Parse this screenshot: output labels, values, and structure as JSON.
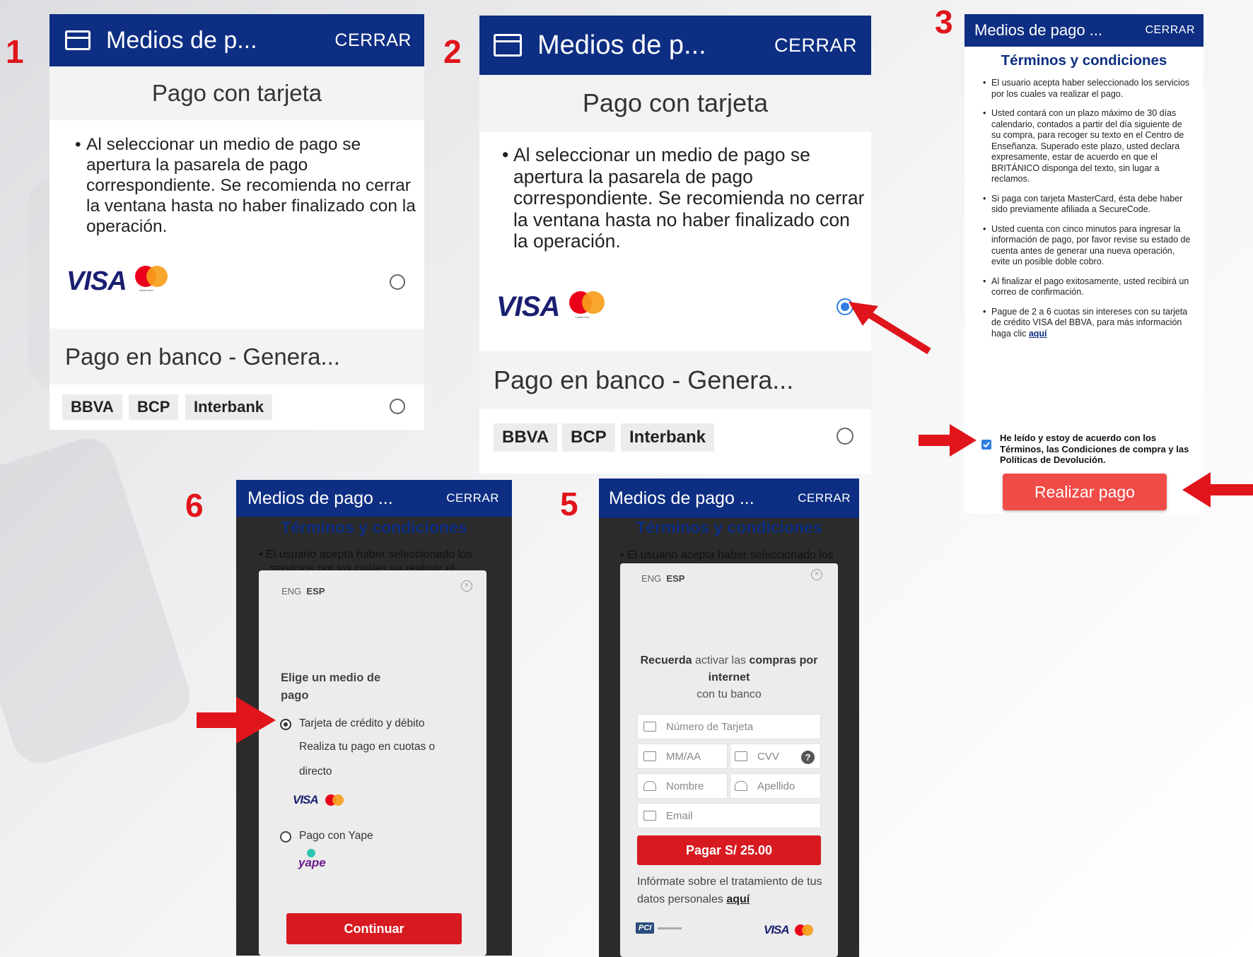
{
  "steps": {
    "s1": "1",
    "s2": "2",
    "s3": "3",
    "s5": "5",
    "s6": "6"
  },
  "panel1": {
    "header_title": "Medios de p...",
    "close_label": "CERRAR",
    "section_title": "Pago con tarjeta",
    "description": "Al seleccionar un medio de pago se apertura la pasarela de pago correspondiente. Se recomienda no cerrar la ventana hasta no haber finalizado con la operación.",
    "visa": "VISA",
    "mastercard": "mastercard",
    "bank_title": "Pago en banco - Genera...",
    "banks": [
      "BBVA",
      "BCP",
      "Interbank"
    ]
  },
  "panel2": {
    "header_title": "Medios de p...",
    "close_label": "CERRAR",
    "section_title": "Pago con tarjeta",
    "description": "Al seleccionar un medio de pago se apertura la pasarela de pago correspondiente. Se recomienda no cerrar la ventana hasta no haber finalizado con la operación.",
    "visa": "VISA",
    "mastercard": "mastercard",
    "bank_title": "Pago en banco - Genera...",
    "banks": [
      "BBVA",
      "BCP",
      "Interbank"
    ]
  },
  "panel3": {
    "header_title": "Medios de pago ...",
    "close_label": "CERRAR",
    "terms_title": "Términos y condiciones",
    "terms": [
      "El usuario acepta haber seleccionado los servicios por los cuales va realizar el pago.",
      "Usted contará con un plazo máximo de 30 días calendario, contados a partir del día siguiente de su compra, para recoger su texto en el Centro de Enseñanza. Superado este plazo, usted declara expresamente, estar de acuerdo en que el BRITÁNICO disponga del texto, sin lugar a reclamos.",
      "Si paga con tarjeta MasterCard, ésta debe haber sido previamente afiliada a SecureCode.",
      "Usted cuenta con cinco minutos para ingresar la información de pago, por favor revise su estado de cuenta antes de generar una nueva operación, evite un posible doble cobro.",
      "Al finalizar el pago exitosamente, usted recibirá un correo de confirmación."
    ],
    "last_term": "Pague de 2 a 6 cuotas sin intereses con su tarjeta de crédito VISA del BBVA, para más información haga clic",
    "last_term_link": "aquí",
    "checkbox_label": "He leído y estoy de acuerdo con los Términos, las Condiciones de compra y las Políticas de Devolución.",
    "pay_button": "Realizar pago"
  },
  "panel6": {
    "header_title": "Medios de pago ...",
    "close_label": "CERRAR",
    "bg_title": "Términos y condiciones",
    "bg_line1": "• El usuario acepta haber seleccionado los",
    "bg_line2": "servicios por los cuales va realizar el",
    "lang_eng": "ENG",
    "lang_esp": "ESP",
    "choose_title": "Elige un medio de pago",
    "option_card": "Tarjeta de crédito y débito",
    "option_card_desc": "Realiza tu pago en cuotas o directo",
    "visa": "VISA",
    "option_yape": "Pago con Yape",
    "yape_logo": "yape",
    "continue_button": "Continuar"
  },
  "panel5": {
    "header_title": "Medios de pago ...",
    "close_label": "CERRAR",
    "bg_title": "Términos y condiciones",
    "bg_line1": "• El usuario acepta haber seleccionado los",
    "lang_eng": "ENG",
    "lang_esp": "ESP",
    "reminder_bold1": "Recuerda",
    "reminder_mid": " activar las ",
    "reminder_bold2": "compras por internet",
    "reminder_tail": "con tu banco",
    "card_number_placeholder": "Número de Tarjeta",
    "expiry_placeholder": "MM/AA",
    "cvv_placeholder": "CVV",
    "first_name_placeholder": "Nombre",
    "last_name_placeholder": "Apellido",
    "email_placeholder": "Email",
    "pay_button": "Pagar S/ 25.00",
    "privacy_text": "Infórmate sobre el tratamiento de tus datos personales",
    "privacy_link": "aquí",
    "pci_logo": "PCI",
    "visa": "VISA"
  },
  "colors": {
    "header": "#0d2e82",
    "accent_red": "#e0141b",
    "button_red": "#d71a20",
    "pay_button_red": "#ef4b47",
    "radio_blue": "#2f7de1"
  }
}
